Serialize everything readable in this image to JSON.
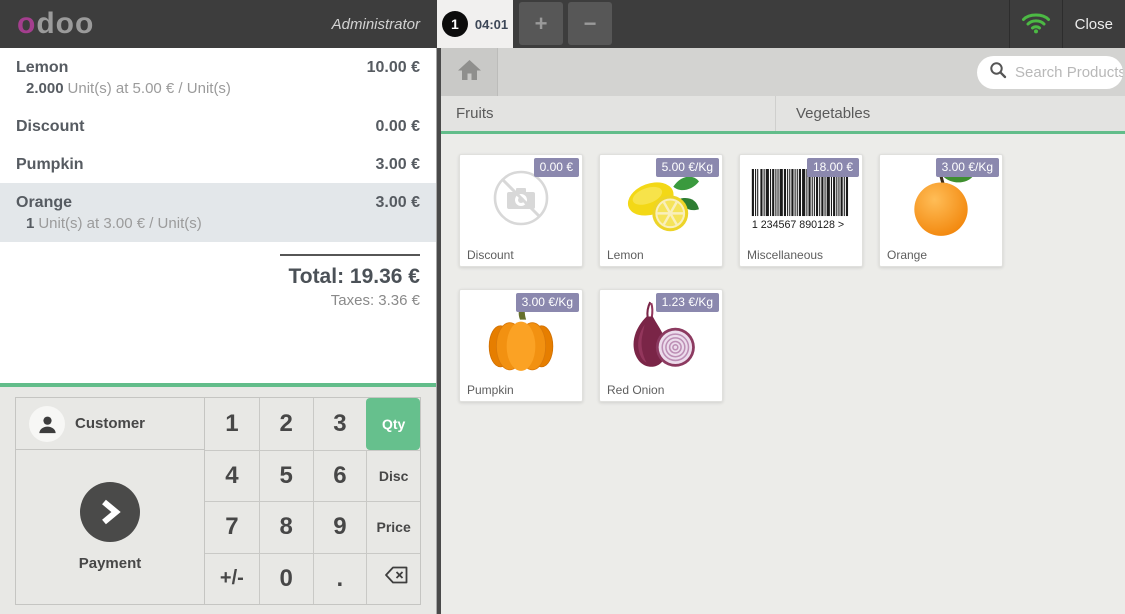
{
  "topbar": {
    "logo_first": "o",
    "logo_rest": "doo",
    "user": "Administrator",
    "tab": {
      "badge": "1",
      "time": "04:01"
    },
    "add_tab_label": "+",
    "remove_tab_label": "−",
    "close_label": "Close"
  },
  "order": {
    "lines": [
      {
        "name": "Lemon",
        "price": "10.00 €",
        "qty": "2.000",
        "detail": "Unit(s) at 5.00 € / Unit(s)",
        "selected": false
      },
      {
        "name": "Discount",
        "price": "0.00 €",
        "selected": false
      },
      {
        "name": "Pumpkin",
        "price": "3.00 €",
        "selected": false
      },
      {
        "name": "Orange",
        "price": "3.00 €",
        "qty": "1",
        "detail": "Unit(s) at 3.00 € / Unit(s)",
        "selected": true
      }
    ],
    "total_label": "Total:",
    "total_value": "19.36 €",
    "taxes": "Taxes: 3.36 €"
  },
  "actionpad": {
    "customer_label": "Customer",
    "payment_label": "Payment"
  },
  "numpad": {
    "keys": [
      [
        "1",
        "2",
        "3",
        "Qty"
      ],
      [
        "4",
        "5",
        "6",
        "Disc"
      ],
      [
        "7",
        "8",
        "9",
        "Price"
      ],
      [
        "+/-",
        "0",
        ".",
        "⌫"
      ]
    ]
  },
  "products_screen": {
    "search_placeholder": "Search Products",
    "categories": [
      "Fruits",
      "Vegetables"
    ],
    "products": [
      {
        "name": "Discount",
        "price": "0.00 €",
        "image": "no-photo"
      },
      {
        "name": "Lemon",
        "price": "5.00 €/Kg",
        "image": "lemon"
      },
      {
        "name": "Miscellaneous",
        "price": "18.00 €",
        "image": "barcode",
        "barcode_text": "1 234567 890128 >"
      },
      {
        "name": "Orange",
        "price": "3.00 €/Kg",
        "image": "orange"
      },
      {
        "name": "Pumpkin",
        "price": "3.00 €/Kg",
        "image": "pumpkin"
      },
      {
        "name": "Red Onion",
        "price": "1.23 €/Kg",
        "image": "red-onion"
      }
    ]
  },
  "colors": {
    "accent_green": "#62bd8a",
    "qty_green": "#66c08d",
    "tag_purple": "#8b88ae",
    "topbar_bg": "#3d3d3d",
    "wifi_green": "#4cb944",
    "logo_magenta": "#a43e8e",
    "selected_row": "#e3e7ea"
  }
}
